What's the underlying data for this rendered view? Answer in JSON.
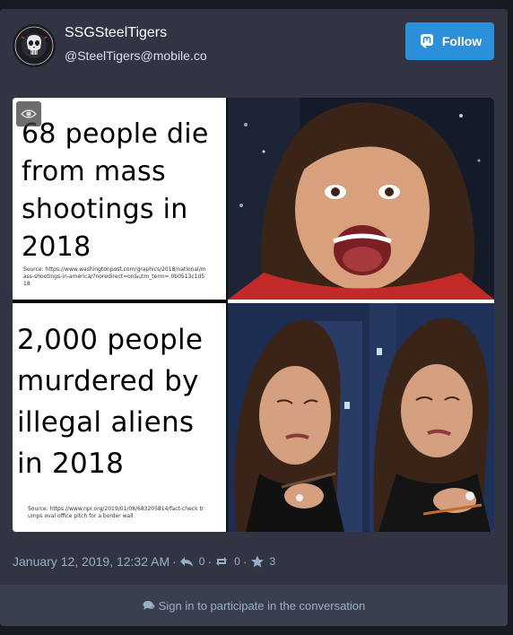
{
  "account": {
    "display_name": "SSGSteelTigers",
    "handle": "@SteelTigers@mobile.co"
  },
  "follow_label": "Follow",
  "media": {
    "panel_top_left": {
      "headline": "68 people die from mass shootings in 2018",
      "source": "Source: https://www.washingtonpost.com/graphics/2018/national/mass-shootings-in-america/?noredirect=on&utm_term=.0b0513c1d518"
    },
    "panel_bottom_left": {
      "headline": "2,000 people murdered by illegal aliens in 2018",
      "source": "Source: https://www.npr.org/2019/01/08/683205814/fact-check trumps oval office pitch for a border wall"
    }
  },
  "status": {
    "timestamp": "January 12, 2019, 12:32 AM",
    "replies": "0",
    "reblogs": "0",
    "favourites": "3"
  },
  "footer_text": "Sign in to participate in the conversation",
  "colors": {
    "accent": "#2b90d9",
    "card_bg": "#313543",
    "page_bg": "#191b22",
    "muted_text": "#9baec8"
  }
}
